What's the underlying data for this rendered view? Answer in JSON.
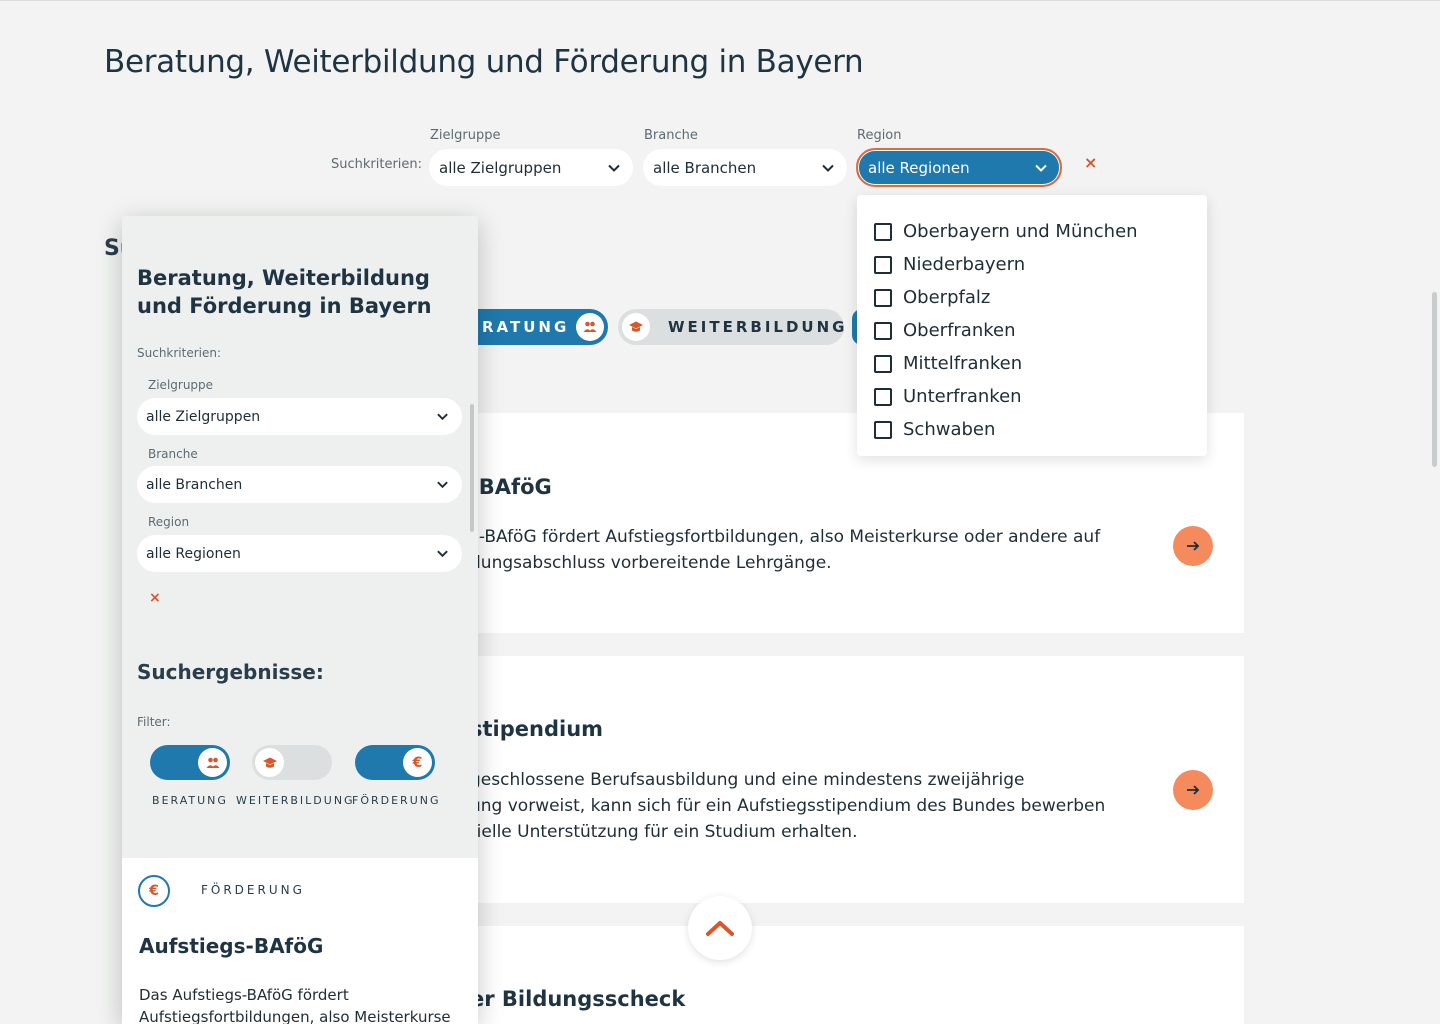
{
  "page": {
    "title": "Beratung, Weiterbildung und Förderung in Bayern",
    "search_criteria_label": "Suchkriterien:",
    "results_heading_partial": "Su"
  },
  "filters": {
    "zielgruppe": {
      "label": "Zielgruppe",
      "value": "alle Zielgruppen"
    },
    "branche": {
      "label": "Branche",
      "value": "alle Branchen"
    },
    "region": {
      "label": "Region",
      "value": "alle Regionen"
    },
    "clear_symbol": "×"
  },
  "region_dropdown": {
    "options": [
      "Oberbayern und München",
      "Niederbayern",
      "Oberpfalz",
      "Oberfranken",
      "Mittelfranken",
      "Unterfranken",
      "Schwaben"
    ]
  },
  "category_pills": {
    "beratung_partial": "RATUNG",
    "weiterbildung": "WEITERBILDUNG"
  },
  "cards": [
    {
      "title_partial": "-BAföG",
      "text_line1": "s-BAföG fördert Aufstiegsfortbildungen, also Meisterkurse oder andere auf",
      "text_line2": "dungsabschluss vorbereitende Lehrgänge."
    },
    {
      "title_partial": "stipendium",
      "text_line1": "geschlossene Berufsausbildung und eine mindestens zweijährige",
      "text_line2": "ung vorweist, kann sich für ein Aufstiegsstipendium des Bundes bewerben",
      "text_line3": "tielle Unterstützung für ein Studium erhalten."
    },
    {
      "title_partial": "er Bildungsscheck"
    }
  ],
  "mobile_panel": {
    "title": "Beratung, Weiterbildung und Förderung in Bayern",
    "search_criteria_label": "Suchkriterien:",
    "zielgruppe": {
      "label": "Zielgruppe",
      "value": "alle Zielgruppen"
    },
    "branche": {
      "label": "Branche",
      "value": "alle Branchen"
    },
    "region": {
      "label": "Region",
      "value": "alle Regionen"
    },
    "clear_symbol": "×",
    "results_heading": "Suchergebnisse:",
    "filter_label": "Filter:",
    "toggles": [
      {
        "label": "BERATUNG",
        "on": true,
        "icon": "people-icon"
      },
      {
        "label": "WEITERBILDUNG",
        "on": false,
        "icon": "graduation-cap-icon"
      },
      {
        "label": "FÖRDERUNG",
        "on": true,
        "icon": "euro-icon"
      }
    ],
    "card": {
      "category": "FÖRDERUNG",
      "euro_symbol": "€",
      "title": "Aufstiegs-BAföG",
      "text_line1": "Das Aufstiegs-BAföG fördert",
      "text_line2": "Aufstiegsfortbildungen, also Meisterkurse"
    }
  },
  "colors": {
    "primary_blue": "#1f79ad",
    "accent_orange": "#f58a5c",
    "accent_red": "#d9552a",
    "background": "#f2f3f2"
  }
}
